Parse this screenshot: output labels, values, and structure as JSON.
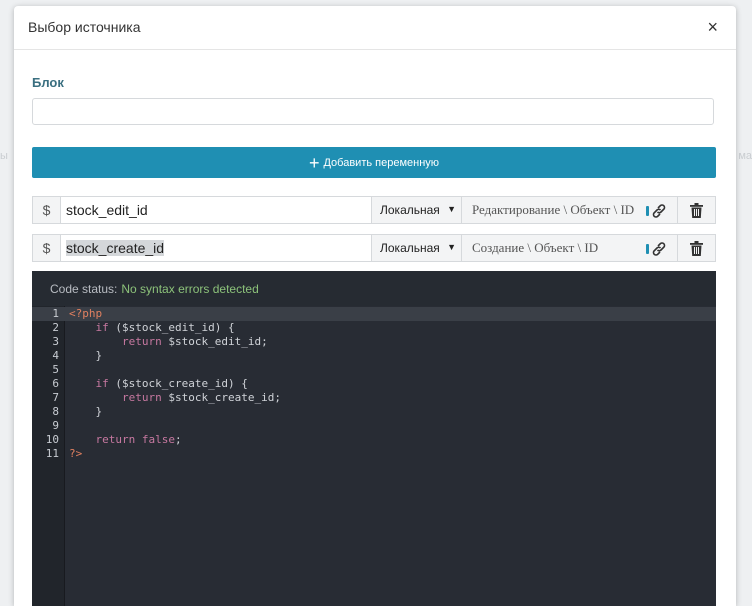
{
  "background": {
    "left_text": "ы",
    "right_text": "ма"
  },
  "modal": {
    "title": "Выбор источника",
    "close_label": "×",
    "block_label": "Блок",
    "block_value": "",
    "add_button_label": "Добавить переменную"
  },
  "variables": [
    {
      "prefix": "$",
      "name": "stock_edit_id",
      "scope": "Локальная",
      "path": "Редактирование \\ Объект \\ ID",
      "link_icon": "link-icon",
      "delete_icon": "trash-icon"
    },
    {
      "prefix": "$",
      "name": "stock_create_id",
      "scope": "Локальная",
      "path": "Создание \\ Объект \\ ID",
      "link_icon": "link-icon",
      "delete_icon": "trash-icon"
    }
  ],
  "editor": {
    "status_label": "Code status:",
    "status_value": "No syntax errors detected",
    "lines": [
      {
        "n": "1",
        "text": "<?php"
      },
      {
        "n": "2",
        "text": "    if ($stock_edit_id) {"
      },
      {
        "n": "3",
        "text": "        return $stock_edit_id;"
      },
      {
        "n": "4",
        "text": "    }"
      },
      {
        "n": "5",
        "text": ""
      },
      {
        "n": "6",
        "text": "    if ($stock_create_id) {"
      },
      {
        "n": "7",
        "text": "        return $stock_create_id;"
      },
      {
        "n": "8",
        "text": "    }"
      },
      {
        "n": "9",
        "text": ""
      },
      {
        "n": "10",
        "text": "    return false;"
      },
      {
        "n": "11",
        "text": "?>"
      }
    ]
  },
  "colors": {
    "accent": "#1f8fb3",
    "label": "#3a6f80",
    "editor_bg": "#282c34",
    "status_ok": "#8cc27a"
  }
}
